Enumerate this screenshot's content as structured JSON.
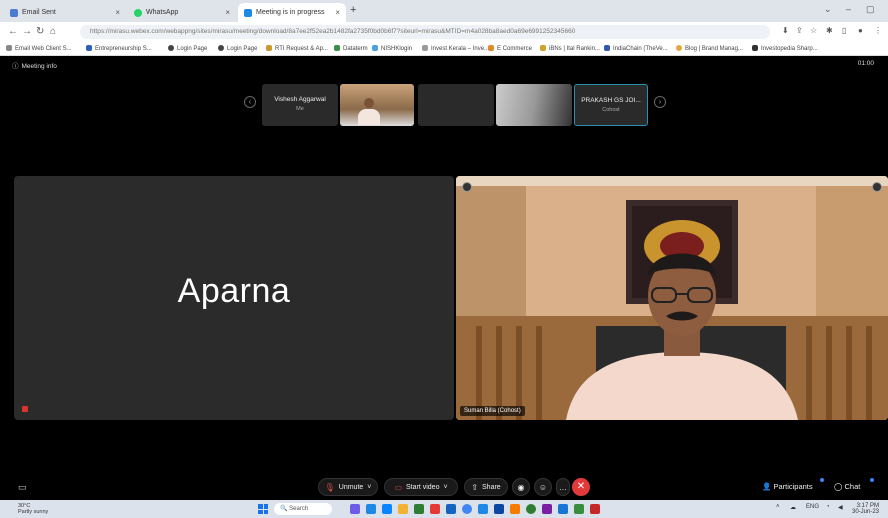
{
  "browser": {
    "tabs": [
      {
        "label": "Email Sent",
        "fav_color": "#4a7bd1"
      },
      {
        "label": "WhatsApp",
        "fav_color": "#25d366"
      },
      {
        "label": "Meeting is in progress",
        "fav_color": "#1e88e5",
        "active": true
      }
    ],
    "new_tab": "+",
    "url": "https://mirasu.webex.com/webappng/sites/mirasu/meeting/download/8a7ee2f52ea2b1482fa2735f0bd0b6f7?siteurl=mirasu&MTID=m4a028ba8aed0a69e6991252345660",
    "bookmarks": [
      "Email Web Client S...",
      "Entrepreneurship S...",
      "Login Page",
      "Login Page",
      "RTI Request & Ap...",
      "Dataterm",
      "NISHKlogin",
      "Invest Kerala – Inve...",
      "E Commerce",
      "iBNs | Ital Rankin...",
      "IndiaChain (TheVe...",
      "Blog | Brand Manag...",
      "Investopedia Sharp..."
    ]
  },
  "meeting": {
    "info_label": "Meeting info",
    "clock": "01:00",
    "thumbnails": [
      {
        "name": "Vishesh Aggarwal",
        "sub": "Me"
      },
      {
        "name": "",
        "sub": ""
      },
      {
        "name": "",
        "sub": ""
      },
      {
        "name": "",
        "sub": ""
      },
      {
        "name": "PRAKASH GS JOI...",
        "sub": "Cohost"
      }
    ],
    "main_left_name": "Aparna",
    "main_right_tag": "Suman Billa (Cohost)",
    "controls": {
      "unmute": "Unmute",
      "start_video": "Start video",
      "share": "Share",
      "participants": "Participants",
      "chat": "Chat"
    }
  },
  "taskbar": {
    "weather_temp": "30°C",
    "weather_desc": "Partly sunny",
    "search_placeholder": "Search",
    "lang": "ENG",
    "time": "3:17 PM",
    "date": "30-Jun-23"
  },
  "colors": {
    "end_call": "#e23a3a",
    "selected_border": "#2a8fb3",
    "mic_muted": "#d9322f"
  }
}
